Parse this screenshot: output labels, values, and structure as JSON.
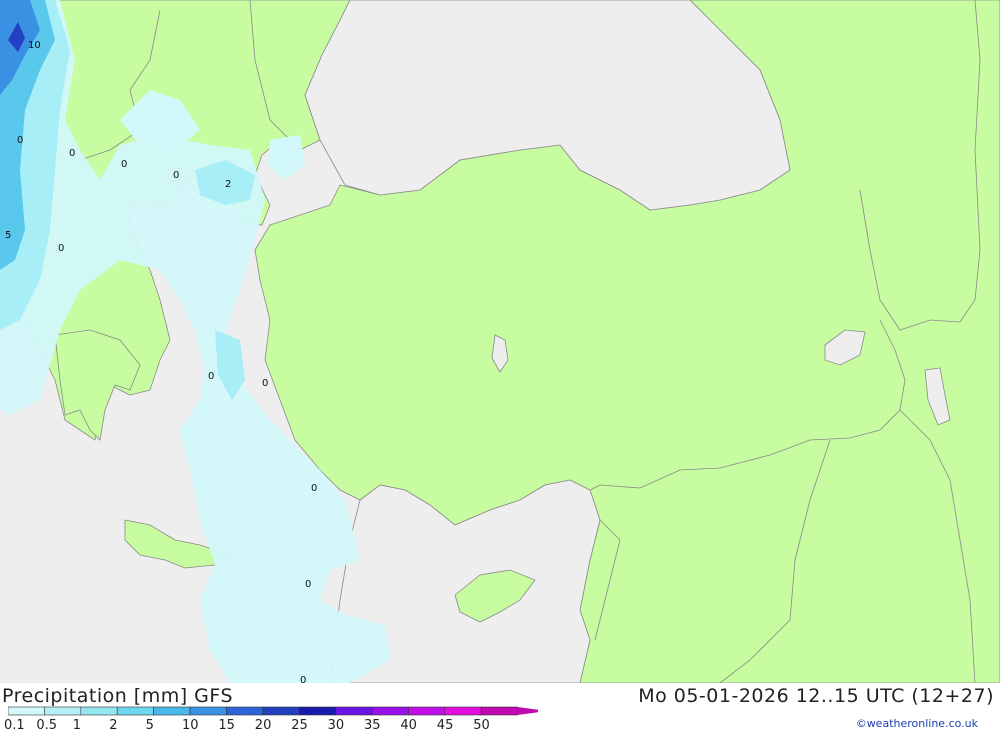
{
  "header": {
    "title_left": "Precipitation [mm] GFS",
    "title_right": "Mo 05-01-2026 12..15 UTC (12+27)"
  },
  "colors": {
    "sea": "#eeeeee",
    "land": "#c8fca0",
    "border": "#8a8a8a",
    "precip_light": "#d2f8fa",
    "precip_mid": "#a8eef6",
    "precip_heavy": "#5ac8ec"
  },
  "contour_labels": [
    "10",
    "0",
    "0",
    "0",
    "0",
    "2",
    "5",
    "0",
    "0",
    "0",
    "0",
    "0",
    "0"
  ],
  "legend": {
    "labels": [
      "0.1",
      "0.5",
      "1",
      "2",
      "5",
      "10",
      "15",
      "20",
      "25",
      "30",
      "35",
      "40",
      "45",
      "50"
    ],
    "colors": [
      "#d2f8fa",
      "#b4f0f6",
      "#96e6f2",
      "#6ed6ee",
      "#4ab8ea",
      "#3a90e2",
      "#2e64d6",
      "#2440c2",
      "#1a1aa8",
      "#6a14e6",
      "#9a10ea",
      "#c00ee6",
      "#e20ce0",
      "#c00ab0"
    ]
  },
  "credit": "©weatheronline.co.uk"
}
